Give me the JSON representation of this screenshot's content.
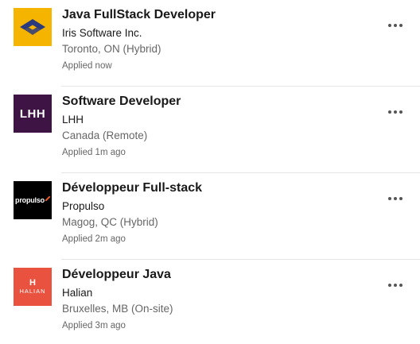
{
  "jobs": [
    {
      "title": "Java FullStack Developer",
      "company": "Iris Software Inc.",
      "location": "Toronto, ON (Hybrid)",
      "status": "Applied now",
      "logo": {
        "icon": "iris-logo",
        "bg": "#f5b400"
      }
    },
    {
      "title": "Software Developer",
      "company": "LHH",
      "location": "Canada (Remote)",
      "status": "Applied 1m ago",
      "logo": {
        "icon": "lhh-logo",
        "text": "LHH",
        "bg": "#3d1444"
      }
    },
    {
      "title": "Développeur Full-stack",
      "company": "Propulso",
      "location": "Magog, QC (Hybrid)",
      "status": "Applied 2m ago",
      "logo": {
        "icon": "propulso-logo",
        "text": "propulso",
        "bg": "#000000",
        "accent": "#f15a22"
      }
    },
    {
      "title": "Développeur Java",
      "company": "Halian",
      "location": "Bruxelles, MB (On-site)",
      "status": "Applied 3m ago",
      "logo": {
        "icon": "halian-logo",
        "mark": "H",
        "text": "HALIAN",
        "bg": "#e8523f"
      }
    }
  ],
  "more_icon": "ellipsis-icon"
}
